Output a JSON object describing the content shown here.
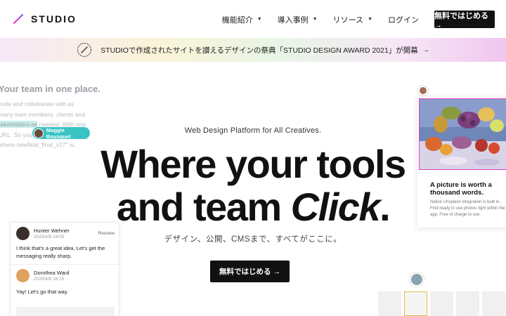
{
  "header": {
    "logo_text": "STUDIO",
    "nav": [
      "機能紹介",
      "導入事例",
      "リソース"
    ],
    "login": "ログイン",
    "cta": "無料ではじめる →"
  },
  "banner": {
    "text": "STUDIOで作成されたサイトを讃えるデザインの祭典「STUDIO DESIGN AWARD 2021」が開幕",
    "arrow": "→"
  },
  "left_card": {
    "title": "Your team in one place.",
    "text_before": "nvite and collaborate with as many eam members, clients and ",
    "text_highlight": "takeholders as",
    "text_after": " needed. With one URL. So you t... keep track of where newfinal_final_v27\" is.",
    "cursor_name": "Maggie Bousquet"
  },
  "hero": {
    "subtitle": "Web Design Platform for All Creatives.",
    "line1": "Where your tools",
    "line2_prefix": "and team ",
    "line2_em": "Click",
    "line2_suffix": ".",
    "ja": "デザイン、公開、CMSまで、すべてがここに。",
    "cta": "無料ではじめる →"
  },
  "comments": {
    "resolve": "Resolve",
    "items": [
      {
        "name": "Hunter Wehner",
        "date": "2020/4/8 14:05",
        "message": "I think that's a great idea. Let's get the messaging really sharp."
      },
      {
        "name": "Dorothea Ward",
        "date": "2020/4/8 16:15",
        "message": "Yay! Let's go that way."
      }
    ]
  },
  "image_card": {
    "title": "A picture is worth a thousand words.",
    "desc": "Native Unsplash integration is built in. Find ready to use photos right within the app. Free of charge to use."
  },
  "colors": {
    "accent_pink": "#e23fbf",
    "teal_cursor": "#39c3c3",
    "dark": "#111111"
  }
}
